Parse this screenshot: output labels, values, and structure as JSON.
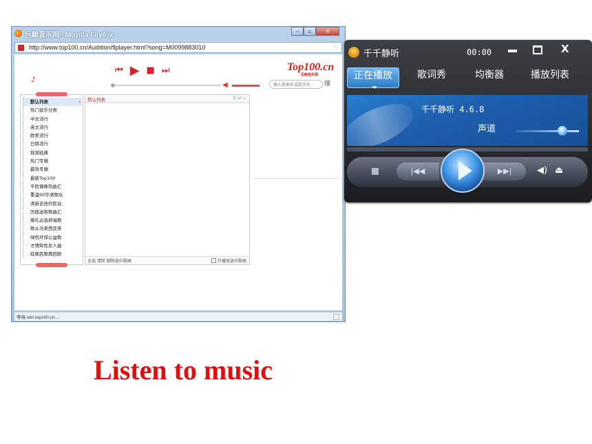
{
  "firefox": {
    "title": "巨鲸音乐网 - Mozilla Firefox",
    "controls": [
      "–",
      "▫",
      "✕"
    ],
    "url": "http://www.top100.cn/Audition/flplayer.html?song=M0099883010",
    "status": "等待 cdn.top100.cn…"
  },
  "web_player": {
    "logo": "Top100.cn",
    "logo_sub": "巨鲸音乐网",
    "search_placeholder": "输入歌曲名或歌手名",
    "search_button": "搜",
    "transport": {
      "prev": "⏮",
      "play": "▶",
      "stop": "■",
      "next": "⏭"
    },
    "categories": [
      "默认列表",
      "热门音乐分类",
      "中文流行",
      "英文流行",
      "欧美流行",
      "日韩流行",
      "摇滚经典",
      "热门专辑",
      "最热专辑",
      "最新Top100",
      "平民偶像热曲汇",
      "重温90华语歌坛",
      "清新吉他作民谣",
      "历届迷笛歌曲汇",
      "婚礼必选祝福歌",
      "歌从马来西亚来",
      "绿色环保公益歌",
      "才情知性女人曲",
      "经典民歌再回顾"
    ],
    "list_title": "默认列表",
    "list_footer_left": "全选 清除  删除选中歌曲",
    "list_footer_right": "只播放选中歌曲"
  },
  "ttplayer": {
    "name": "千千静听",
    "time": "00:00",
    "tabs": [
      "正在播放",
      "歌词秀",
      "均衡器",
      "播放列表"
    ],
    "active_tab": "正在播放",
    "version": "千千静听 4.6.8",
    "channel": "声道"
  },
  "caption": "Listen to music",
  "colors": {
    "accent_red": "#e01010",
    "tt_blue": "#2c7cc7"
  }
}
